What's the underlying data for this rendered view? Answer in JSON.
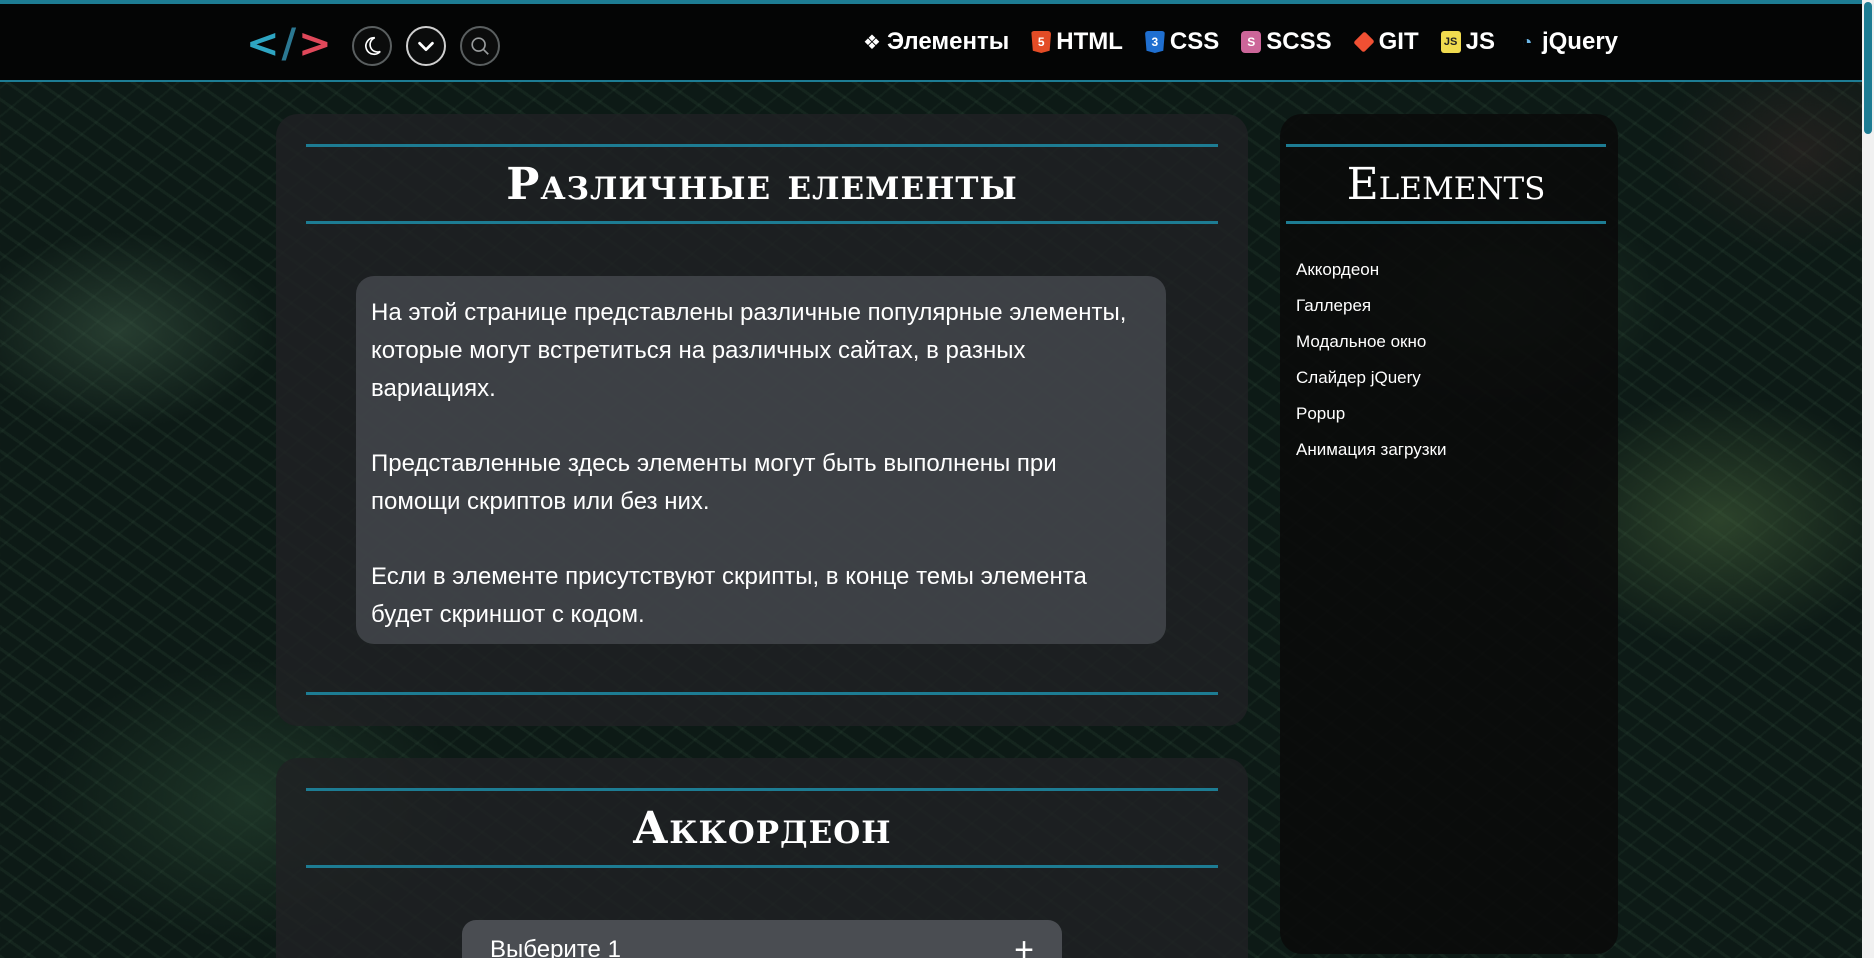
{
  "header": {
    "logo": {
      "lt": "<",
      "slash": "/",
      "gt": ">"
    },
    "buttons": [
      {
        "name": "theme-toggle",
        "icon": "moon-icon"
      },
      {
        "name": "menu-toggle",
        "icon": "chevron-down-icon"
      },
      {
        "name": "search",
        "icon": "search-icon"
      }
    ],
    "nav": [
      {
        "label": "Элементы",
        "icon": "cubes-icon"
      },
      {
        "label": "HTML",
        "icon": "html5-icon",
        "badge": "5"
      },
      {
        "label": "CSS",
        "icon": "css3-icon",
        "badge": "3"
      },
      {
        "label": "SCSS",
        "icon": "sass-icon",
        "badge": "S"
      },
      {
        "label": "GIT",
        "icon": "git-icon"
      },
      {
        "label": "JS",
        "icon": "js-icon",
        "badge": "JS"
      },
      {
        "label": "jQuery",
        "icon": "jquery-icon"
      }
    ]
  },
  "main": {
    "intro_card": {
      "title": "Различные елементы",
      "paragraphs": [
        "На этой странице представлены различные популярные элементы, которые могут встретиться на различных сайтах, в разных вариациях.",
        "Представленные здесь элементы могут быть выполнены при помощи скриптов или без них.",
        "Если в элементе присутствуют скрипты, в конце темы элемента будет скриншот с кодом."
      ]
    },
    "accordion_card": {
      "title": "Аккордеон",
      "items": [
        {
          "label": "Выберите 1",
          "toggle": "+"
        }
      ]
    }
  },
  "sidebar": {
    "title": "Elements",
    "items": [
      "Аккордеон",
      "Галлерея",
      "Модальное окно",
      "Слайдер jQuery",
      "Popup",
      "Анимация загрузки"
    ]
  },
  "colors": {
    "accent": "#1d7c93",
    "logo_bracket": "#2ea5c2",
    "logo_gt": "#e0485a",
    "header_bg": "#040505"
  }
}
